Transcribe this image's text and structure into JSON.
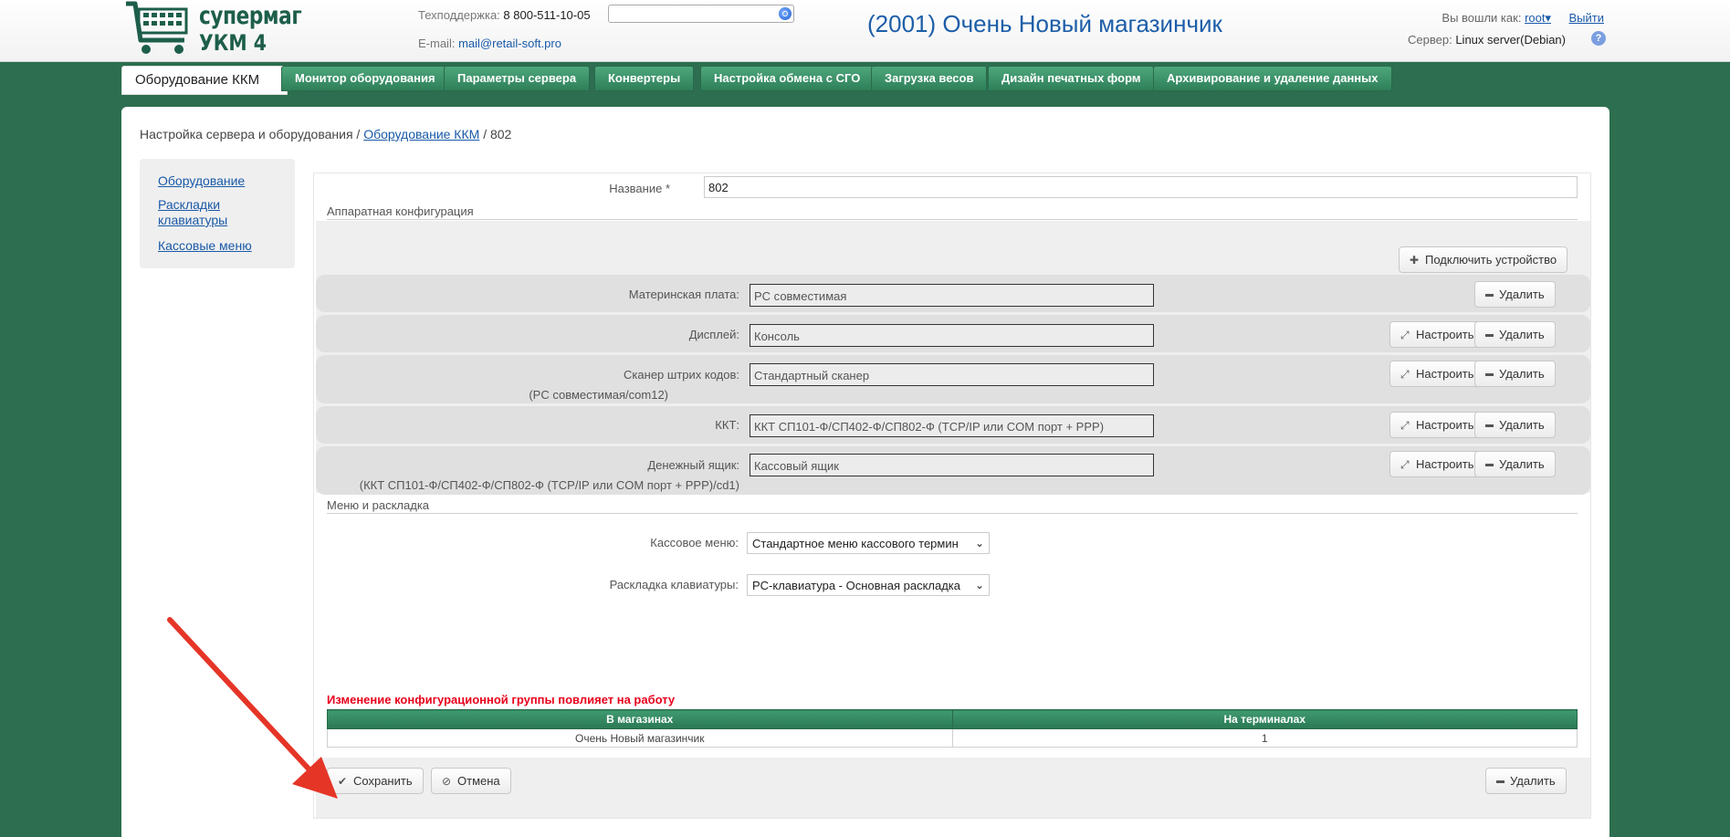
{
  "header": {
    "logo_line1": "супермаг",
    "logo_line2": "УКМ 4",
    "support_label": "Техподдержка:",
    "support_phone": "8 800-511-10-05",
    "email_label": "E-mail:",
    "email": "mail@retail-soft.pro",
    "search_value": "",
    "shop_title": "(2001) Очень Новый магазинчик",
    "logged_in_label": "Вы вошли как:",
    "user": "root",
    "user_caret": "▾",
    "logout": "Выйти",
    "server_label": "Сервер:",
    "server_value": "Linux server(Debian)",
    "help": "?"
  },
  "tabs": [
    {
      "label": "Оборудование ККМ",
      "active": true
    },
    {
      "label": "Монитор оборудования"
    },
    {
      "label": "Параметры сервера"
    },
    {
      "label": "Конвертеры"
    },
    {
      "label": "Настройка обмена с СГО"
    },
    {
      "label": "Загрузка весов"
    },
    {
      "label": "Дизайн печатных форм"
    },
    {
      "label": "Архивирование и удаление данных"
    }
  ],
  "breadcrumb": {
    "root": "Настройка сервера и оборудования",
    "sep": "/",
    "link": "Оборудование ККМ",
    "current": "802"
  },
  "sidenav": [
    "Оборудование",
    "Раскладки клавиатуры",
    "Кассовые меню"
  ],
  "form": {
    "name_label": "Название *",
    "name_value": "802",
    "hw_section": "Аппаратная конфигурация",
    "connect_button": "Подключить устройство",
    "configure_label": "Настроить",
    "delete_label": "Удалить",
    "devices": [
      {
        "label": "Материнская плата:",
        "value": "PC совместимая",
        "sub": ""
      },
      {
        "label": "Дисплей:",
        "value": "Консоль",
        "sub": ""
      },
      {
        "label": "Сканер штрих кодов:",
        "value": "Стандартный сканер",
        "sub": "(PC совместимая/com12)"
      },
      {
        "label": "ККТ:",
        "value": "ККТ СП101-Ф/СП402-Ф/СП802-Ф (TCP/IP или COM порт + PPP)",
        "sub": ""
      },
      {
        "label": "Денежный ящик:",
        "value": "Кассовый ящик",
        "sub": "(ККТ СП101-Ф/СП402-Ф/СП802-Ф (TCP/IP или COM порт + PPP)/cd1)"
      }
    ],
    "menu_section": "Меню и раскладка",
    "cash_menu_label": "Кассовое меню:",
    "cash_menu_value": "Стандартное меню кассового термин",
    "keyboard_label": "Раскладка клавиатуры:",
    "keyboard_value": "PC-клавиатура - Основная раскладка",
    "chevron": "⌄",
    "warning": "Изменение конфигурационной группы повлияет на работу",
    "table": {
      "headers": [
        "В магазинах",
        "На терминалах"
      ],
      "rows": [
        [
          "Очень Новый магазинчик",
          "1"
        ]
      ]
    },
    "save_button": "Сохранить",
    "cancel_button": "Отмена",
    "delete_button": "Удалить"
  },
  "colors": {
    "accent_green": "#2e7f59",
    "background": "#2c6e4f",
    "arrow": "#e53527",
    "warning": "#e8001c"
  }
}
